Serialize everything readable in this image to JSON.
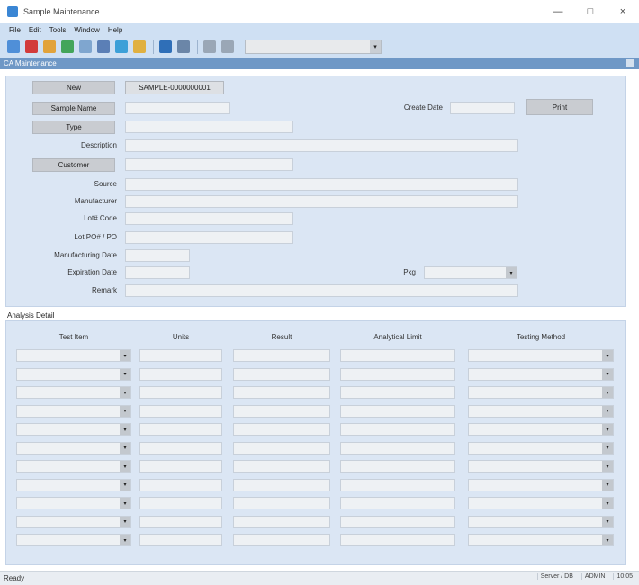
{
  "window": {
    "title": "Sample Maintenance",
    "min": "—",
    "max": "□",
    "close": "×"
  },
  "menu": [
    "File",
    "Edit",
    "Tools",
    "Window",
    "Help"
  ],
  "toolbar": {
    "icons": [
      "new-icon",
      "delete-icon",
      "copy-icon",
      "save-icon",
      "undo-icon",
      "print-icon",
      "search-icon",
      "export-icon",
      "link-icon",
      "calendar-icon",
      "lock-icon",
      "filter-icon"
    ],
    "colors": [
      "#4f8fd8",
      "#d23b3b",
      "#e2a33a",
      "#43a55a",
      "#7fa6cf",
      "#5b7fb6",
      "#3ca0d8",
      "#e0b040",
      "#2f6fb8",
      "#6b86a8",
      "#9aa7b6",
      "#9aa7b6"
    ],
    "combo_value": "",
    "combo_arrow": "▾"
  },
  "panel": {
    "title": "CA Maintenance"
  },
  "form": {
    "new_label": "New",
    "sample_number_value": "SAMPLE-0000000001",
    "sample_name_button": "Sample Name",
    "sample_name_value": "",
    "create_date_label": "Create Date",
    "create_date_value": "",
    "print_button": "Print",
    "type_button": "Type",
    "type_value": "",
    "description_label": "Description",
    "description_value": "",
    "customer_button": "Customer",
    "customer_value": "",
    "source_label": "Source",
    "manufacturer_label": "Manufacturer",
    "lot_code_label": "Lot# Code",
    "lot_po_label": "Lot PO# / PO",
    "mfg_date_label": "Manufacturing Date",
    "expiry_date_label": "Expiration Date",
    "pkg_label": "Pkg",
    "pkg_arrow": "▾",
    "remark_label": "Remark"
  },
  "grid": {
    "title": "Analysis Detail",
    "columns": [
      "Test Item",
      "Units",
      "Result",
      "Analytical Limit",
      "Testing Method"
    ],
    "rows": 11,
    "arrow": "▾"
  },
  "status": {
    "left": "Ready",
    "right": [
      "Server / DB",
      "ADMIN",
      "10:05"
    ]
  }
}
